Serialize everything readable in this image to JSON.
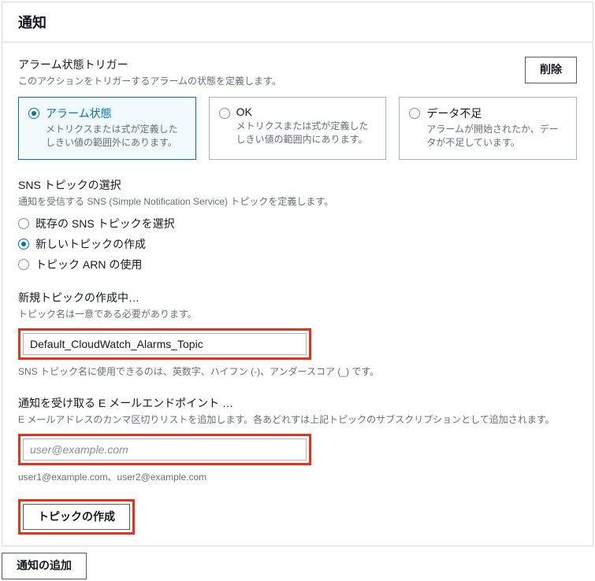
{
  "panel": {
    "title": "通知"
  },
  "trigger": {
    "label": "アラーム状態トリガー",
    "desc": "このアクションをトリガーするアラームの状態を定義します。",
    "delete_btn": "削除",
    "tiles": {
      "alarm": {
        "title": "アラーム状態",
        "desc": "メトリクスまたは式が定義したしきい値の範囲外にあります。"
      },
      "ok": {
        "title": "OK",
        "desc": "メトリクスまたは式が定義したしきい値の範囲内にあります。"
      },
      "insufficient": {
        "title": "データ不足",
        "desc": "アラームが開始されたか、データが不足しています。"
      }
    }
  },
  "sns": {
    "label": "SNS トピックの選択",
    "desc": "通知を受信する SNS (Simple Notification Service) トピックを定義します。",
    "options": {
      "existing": "既存の SNS トピックを選択",
      "create": "新しいトピックの作成",
      "arn": "トピック ARN の使用"
    }
  },
  "new_topic": {
    "label": "新規トピックの作成中…",
    "desc": "トピック名は一意である必要があります。",
    "value": "Default_CloudWatch_Alarms_Topic",
    "hint": "SNS トピック名に使用できるのは、英数字、ハイフン (-)、アンダースコア (_) です。"
  },
  "email": {
    "label": "通知を受け取る E メールエンドポイント …",
    "desc": "E メールアドレスのカンマ区切りリストを追加します。各あどれすは上記トピックのサブスクリプションとして追加されます。",
    "placeholder": "user@example.com",
    "hint": "user1@example.com、user2@example.com"
  },
  "buttons": {
    "create_topic": "トピックの作成",
    "add_notification": "通知の追加"
  }
}
